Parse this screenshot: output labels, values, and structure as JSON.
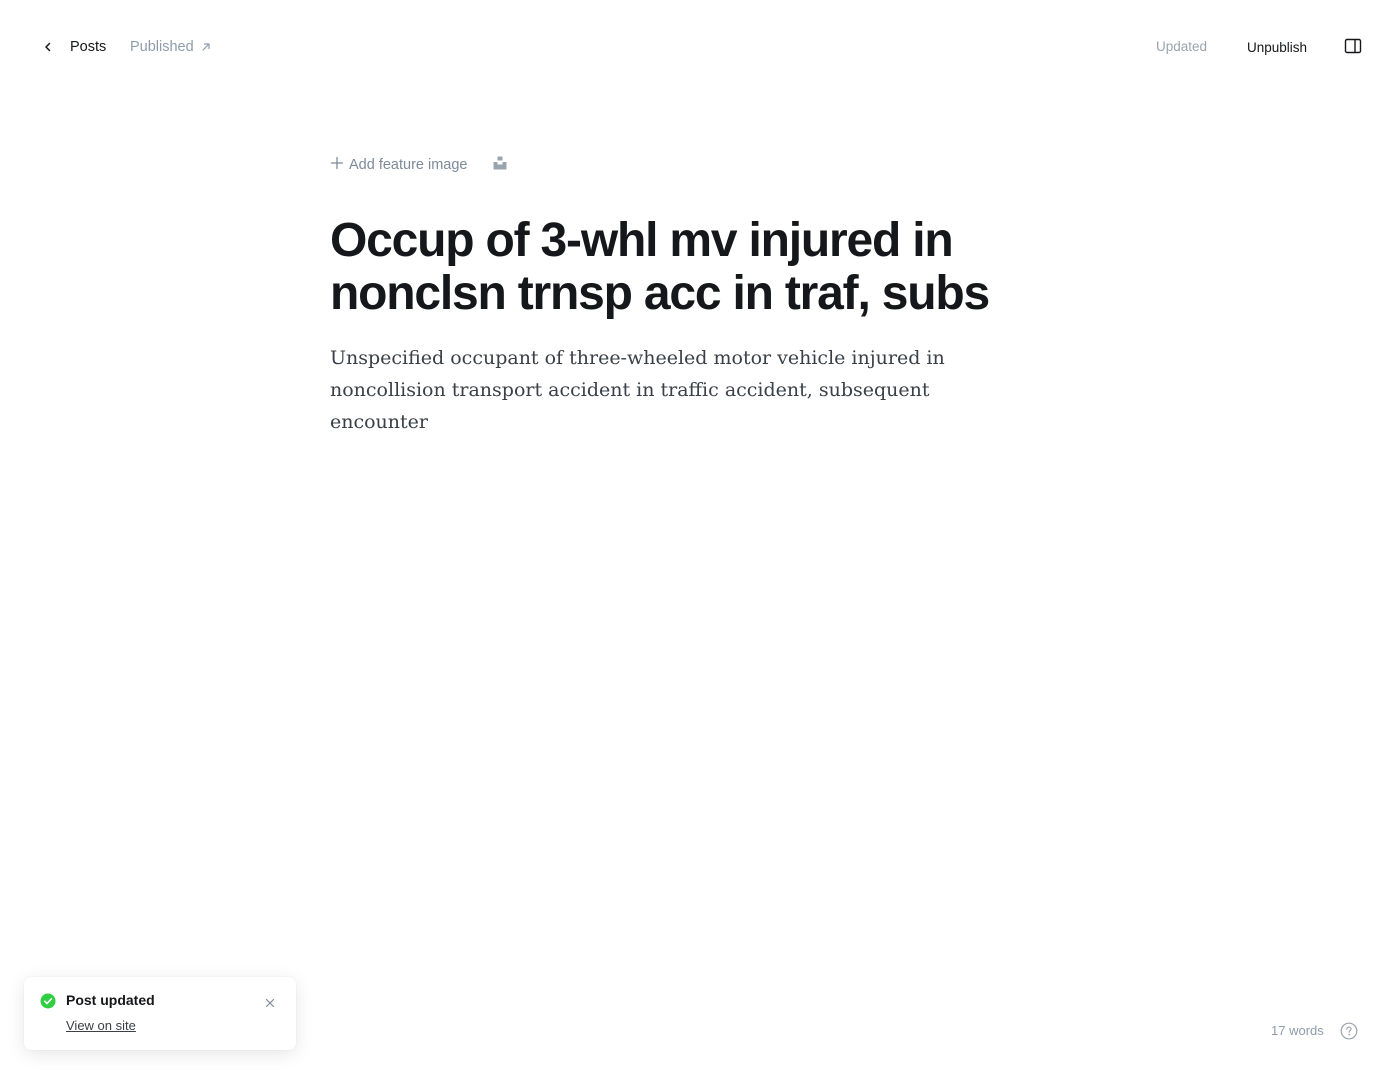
{
  "header": {
    "back_label": "Posts",
    "status_label": "Published",
    "save_state": "Updated",
    "unpublish_label": "Unpublish"
  },
  "editor": {
    "add_feature_image_label": "Add feature image",
    "title": "Occup of 3-whl mv injured in nonclsn trnsp acc in traf, subs",
    "excerpt": "Unspecified occupant of three-wheeled motor vehicle injured in noncollision transport accident in traffic accident, subsequent encounter"
  },
  "toast": {
    "title": "Post updated",
    "link_label": "View on site"
  },
  "footer": {
    "word_count": "17 words"
  },
  "icons": {
    "back": "chevron-left-icon",
    "external": "arrow-up-right-icon",
    "sidebar": "sidebar-panel-icon",
    "add": "plus-icon",
    "unsplash": "unsplash-icon",
    "success": "check-circle-icon",
    "close": "close-icon",
    "help": "question-circle-icon"
  },
  "colors": {
    "success_green": "#30cf43",
    "muted_text": "#8e9cac",
    "primary_text": "#15171a"
  }
}
